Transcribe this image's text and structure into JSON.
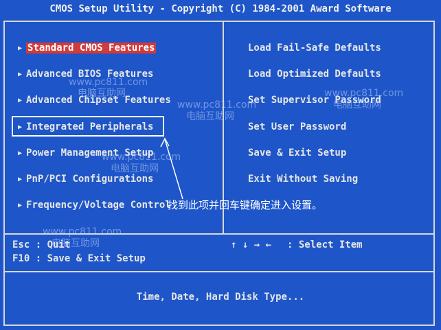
{
  "title": "CMOS Setup Utility - Copyright (C) 1984-2001 Award Software",
  "left_menu": [
    {
      "label": "Standard CMOS Features",
      "selected": true
    },
    {
      "label": "Advanced BIOS Features",
      "selected": false
    },
    {
      "label": "Advanced Chipset Features",
      "selected": false
    },
    {
      "label": "Integrated Peripherals",
      "selected": false
    },
    {
      "label": "Power Management Setup",
      "selected": false
    },
    {
      "label": "PnP/PCI Configurations",
      "selected": false
    },
    {
      "label": "Frequency/Voltage Control",
      "selected": false
    }
  ],
  "right_menu": [
    {
      "label": "Load Fail-Safe Defaults"
    },
    {
      "label": "Load Optimized Defaults"
    },
    {
      "label": "Set Supervisor Password"
    },
    {
      "label": "Set User Password"
    },
    {
      "label": "Save & Exit Setup"
    },
    {
      "label": "Exit Without Saving"
    }
  ],
  "help": {
    "esc": "Esc : Quit",
    "f10": "F10 : Save & Exit Setup",
    "arrows": "↑ ↓ → ←",
    "select": ": Select Item"
  },
  "status_line": "Time, Date, Hard Disk Type...",
  "annotation": "找到此项并回车键确定进入设置。",
  "watermarks": [
    {
      "url": "www.pc811.com",
      "name": "电脑互助网"
    },
    {
      "url": "www.pc811.com",
      "name": "电脑互助网"
    },
    {
      "url": "www.pc811.com",
      "name": "电脑互助网"
    },
    {
      "url": "www.pc811.com",
      "name": "电脑互助网"
    },
    {
      "url": "www.pc811.com",
      "name": "电脑互助网"
    }
  ],
  "colors": {
    "background": "#1e56c9",
    "selected": "#d33a3a",
    "text": "#e6e6e6"
  }
}
